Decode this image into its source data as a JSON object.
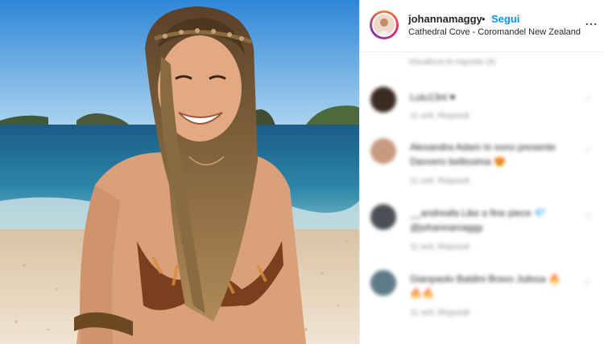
{
  "post": {
    "username": "johannamaggy",
    "separator": "•",
    "follow_label": "Segui",
    "location": "Cathedral Cove - Coromandel New Zealand",
    "more_label": "⋯"
  },
  "comments": {
    "hidden_notice": "Visualizza le risposte (4)",
    "items": [
      {
        "text": "Lulu13nt ♥",
        "meta": "11 sett.   Rispondi"
      },
      {
        "text": "Alexandra Adam Io sono presente Davvero bellissima 😍",
        "meta": "11 sett.   Rispondi"
      },
      {
        "text": "__andreafa Like a fine piece 💎 @johannamaggy",
        "meta": "11 sett.   Rispondi"
      },
      {
        "text": "Gianpaolo Baldini Bravo Julissa 🔥 🔥🔥",
        "meta": "11 sett.   Rispondi"
      }
    ]
  },
  "colors": {
    "follow": "#0095f6",
    "sky_top": "#2f86d8",
    "sea": "#1f6f97",
    "sand": "#e8d7bf"
  },
  "icons": [
    "more-options-icon",
    "heart-icon"
  ]
}
